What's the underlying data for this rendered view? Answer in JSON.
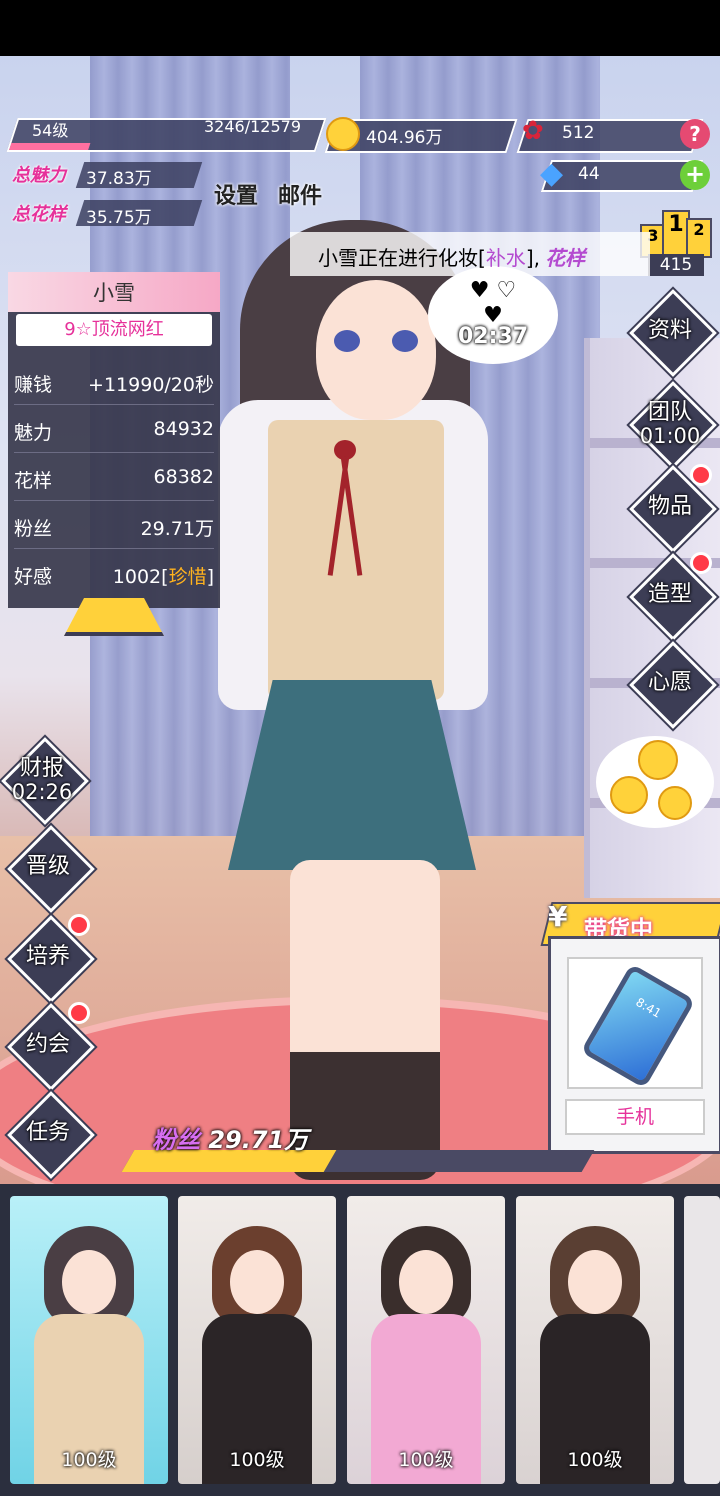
{
  "player": {
    "level": "54级",
    "exp": "3246/12579",
    "exp_fraction": 0.258
  },
  "resources": {
    "gold": "404.96万",
    "roses": "512",
    "diamonds": "44"
  },
  "totals": {
    "charm_label": "总魅力",
    "charm_value": "37.83万",
    "style_label": "总花样",
    "style_value": "35.75万"
  },
  "top_buttons": {
    "settings": "设置",
    "mail": "邮件"
  },
  "ranking": {
    "places": [
      "3",
      "1",
      "2"
    ],
    "score": "415"
  },
  "banner": {
    "prefix": "小雪正在进行化妆[",
    "highlight": "补水",
    "suffix": "],",
    "tail": "花样"
  },
  "thought_timer": "02:37",
  "character_info": {
    "name": "小雪",
    "rank": "9☆顶流网红",
    "rows": [
      {
        "label": "赚钱",
        "value": "+11990/20秒"
      },
      {
        "label": "魅力",
        "value": "84932"
      },
      {
        "label": "花样",
        "value": "68382"
      },
      {
        "label": "粉丝",
        "value": "29.71万"
      }
    ],
    "affection_label": "好感",
    "affection_value": "1002[",
    "affection_tag": "珍惜",
    "affection_close": "]"
  },
  "right_menu": {
    "profile": "资料",
    "team": "团队",
    "team_timer": "01:00",
    "items": "物品",
    "styling": "造型",
    "wish": "心愿"
  },
  "left_menu": {
    "report": "财报",
    "report_timer": "02:26",
    "promote": "晋级",
    "train": "培养",
    "date": "约会",
    "tasks": "任务"
  },
  "selling": {
    "currency": "¥",
    "title": "带货中",
    "item": "手机",
    "phone_time": "8:41"
  },
  "fans_bar": {
    "label": "粉丝",
    "value": "29.71万",
    "fill_fraction": 0.44
  },
  "characters": [
    {
      "level": "100级"
    },
    {
      "level": "100级"
    },
    {
      "level": "100级"
    },
    {
      "level": "100级"
    }
  ],
  "colors": {
    "accent_pink": "#e6319a",
    "gold": "#ffd13a",
    "panel": "#343448",
    "alert_red": "#ff3a47"
  }
}
